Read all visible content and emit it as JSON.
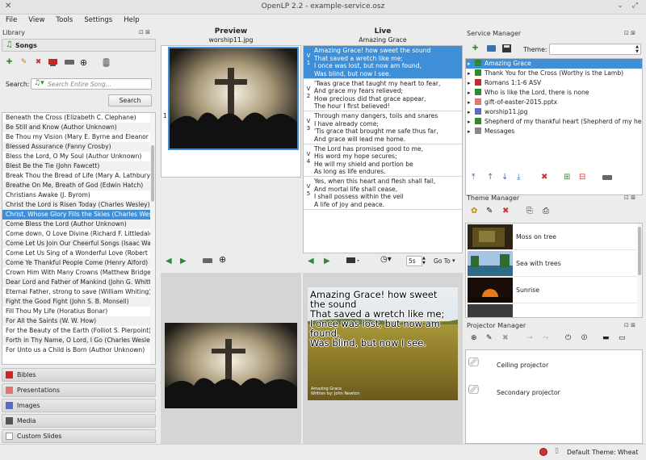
{
  "window": {
    "title": "OpenLP 2.2 - example-service.osz"
  },
  "menu": [
    "File",
    "View",
    "Tools",
    "Settings",
    "Help"
  ],
  "library": {
    "title": "Library",
    "songs_tab": "Songs",
    "search_label": "Search:",
    "search_placeholder": "Search Entire Song...",
    "search_button": "Search",
    "songs": [
      "Beneath the Cross (Elizabeth C. Clephane)",
      "Be Still and Know (Author Unknown)",
      "Be Thou my Vision (Mary E. Byrne and Eleanor H. Hul",
      "Blessed Assurance (Fanny Crosby)",
      "Bless the Lord, O My Soul (Author Unknown)",
      "Blest Be the Tie (John Fawcett)",
      "Break Thou the Bread of Life (Mary A. Lathbury and A",
      "Breathe On Me, Breath of God (Edwin Hatch)",
      "Christians Awake (J. Byrom)",
      "Christ the Lord is Risen Today (Charles Wesley)",
      "Christ, Whose Glory Fills the Skies (Charles Wesley)",
      "Come Bless the Lord (Author Unknown)",
      "Come down, O Love Divine (Richard F. Littledale)",
      "Come Let Us Join Our Cheerful Songs (Isaac Watts)",
      "Come Let Us Sing of a Wonderful Love (Robert Walmsl",
      "Come Ye Thankful People Come (Henry Alford)",
      "Crown Him With Many Crowns (Matthew Bridges and",
      "Dear Lord and Father of Mankind (John G. Whittier)",
      "Eternal Father, strong to save (William Whiting)",
      "Fight the Good Fight (John S. B. Monsell)",
      "Fill Thou My Life (Horatius Bonar)",
      "For All the Saints (W. W. How)",
      "For the Beauty of the Earth (Folliot S. Pierpoint)",
      "Forth in Thy Name, O Lord, I Go (Charles Wesley)",
      "For Unto us a Child is Born (Author Unknown)"
    ],
    "selected_index": 10,
    "sections": [
      "Bibles",
      "Presentations",
      "Images",
      "Media",
      "Custom Slides"
    ]
  },
  "preview": {
    "title": "Preview",
    "subtitle": "worship11.jpg",
    "slide_number": "1"
  },
  "live": {
    "title": "Live",
    "subtitle": "Amazing Grace",
    "verses": [
      {
        "tag": "V\n1",
        "lines": [
          "Amazing Grace! how sweet the sound",
          "That saved a wretch like me;",
          "I once was lost, but now am found,",
          "Was blind, but now I see."
        ]
      },
      {
        "tag": "V\n2",
        "lines": [
          "'Twas grace that taught my heart to fear,",
          "And grace my fears relieved;",
          "How precious did that grace appear,",
          "The hour I first believed!"
        ]
      },
      {
        "tag": "V\n3",
        "lines": [
          "Through many dangers, toils and snares",
          "I have already come;",
          "'Tis grace that brought me safe thus far,",
          "And grace will lead me home."
        ]
      },
      {
        "tag": "V\n4",
        "lines": [
          "The Lord has promised good to me,",
          "His word my hope secures;",
          "He will my shield and portion be",
          "As long as life endures."
        ]
      },
      {
        "tag": "V\n5",
        "lines": [
          "Yes, when this heart and flesh shall fail,",
          "And mortal life shall cease,",
          "I shall possess within the veil",
          "A life of joy and peace."
        ]
      }
    ],
    "delay_value": "5s",
    "goto_label": "Go To",
    "screen_text": [
      "Amazing Grace! how sweet",
      "the sound",
      "That saved a wretch like me;",
      "I once was lost, but now am",
      "found,",
      "Was blind, but now I see."
    ],
    "footer_lines": [
      "Amazing Grace",
      "Written by: John Newton"
    ]
  },
  "service": {
    "title": "Service Manager",
    "theme_label": "Theme:",
    "items": [
      {
        "label": "Amazing Grace",
        "icon": "music-note-icon",
        "color": "#2f8a2f"
      },
      {
        "label": "Thank You for the Cross (Worthy is the Lamb)",
        "icon": "music-note-icon",
        "color": "#2f8a2f"
      },
      {
        "label": "Romans 1:1-6 ASV",
        "icon": "bible-icon",
        "color": "#c62828"
      },
      {
        "label": "Who is like the Lord, there is none",
        "icon": "music-note-icon",
        "color": "#2f8a2f"
      },
      {
        "label": "gift-of-easter-2015.pptx",
        "icon": "presentation-icon",
        "color": "#e57373"
      },
      {
        "label": "worship11.jpg",
        "icon": "image-icon",
        "color": "#5c6bc0"
      },
      {
        "label": "Shepherd of my thankful heart (Shepherd of my he",
        "icon": "music-note-icon",
        "color": "#2f8a2f"
      },
      {
        "label": "Messages",
        "icon": "custom-slide-icon",
        "color": "#888888"
      }
    ],
    "selected_index": 0
  },
  "themes": {
    "title": "Theme Manager",
    "items": [
      "Moss on tree",
      "Sea with trees",
      "Sunrise",
      ""
    ]
  },
  "projectors": {
    "title": "Projector Manager",
    "items": [
      "Ceiling projector",
      "Secondary projector"
    ]
  },
  "status": {
    "default_theme": "Default Theme: Wheat"
  },
  "colors": {
    "selection": "#3f8fd8",
    "background": "#ececec"
  }
}
